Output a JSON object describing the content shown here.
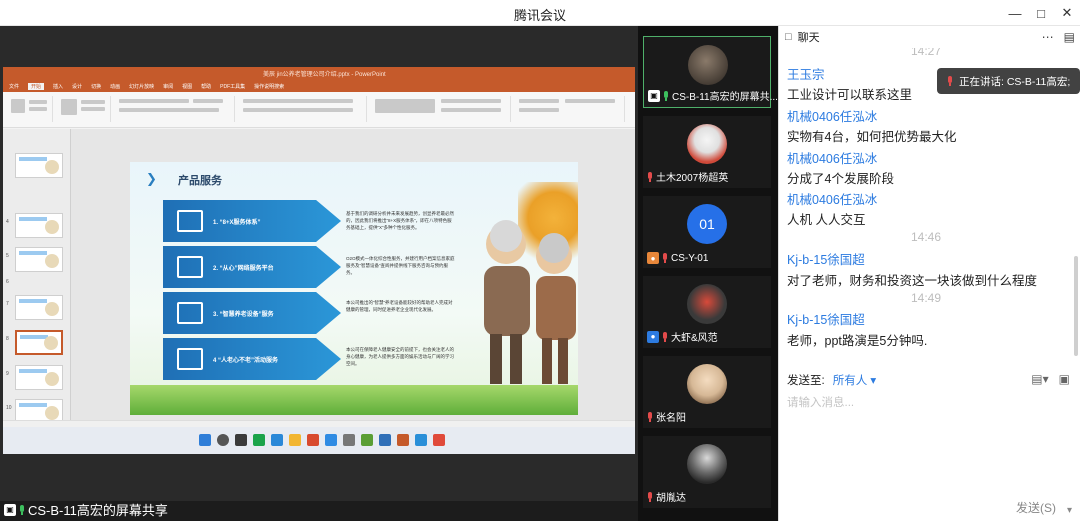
{
  "window": {
    "title": "腾讯会议",
    "min_icon": "minimize-icon",
    "max_icon": "maximize-icon",
    "close_icon": "close-icon"
  },
  "share": {
    "label": "CS-B-11高宏的屏幕共享",
    "ppt": {
      "doc_title": "美辰 jin公养老管理公司介绍.pptx - PowerPoint",
      "tabs": [
        "文件",
        "开始",
        "插入",
        "设计",
        "切换",
        "动画",
        "幻灯片放映",
        "审阅",
        "视图",
        "帮助",
        "PDF工具集",
        "操作说明搜索"
      ],
      "slide_numbers": [
        "4",
        "5",
        "6",
        "7",
        "8",
        "9",
        "10"
      ],
      "slide": {
        "title": "产品服务",
        "services": [
          {
            "label": "1. “8+X服务体系”",
            "desc": "基于我们的调研分析并未来发展趋势，创显养老最必然的，因此我们将推出“8+X服务体系”，即在八项特色服务基础上，提供“X”多种个性化服务。"
          },
          {
            "label": "2. “从心”网络服务平台",
            "desc": "O2O模式一体化综合性服务，并建行用户档案信息家庭服务及“智慧设备”查阅并提供线下服务咨询与预约服务。"
          },
          {
            "label": "3. “智慧养老设备”服务",
            "desc": "本公司推出的“智慧”养老设备能较好的帮助老人完成对健康的管理，同时促进养老企业现代化发展。"
          },
          {
            "label": "4 “人老心不老”活动服务",
            "desc": "本公司在保障老人健康安全的前提下，也会关注老人的身心健康，为老人提供多方面的娱乐活动与广阔的学习空间。"
          }
        ]
      }
    }
  },
  "participants": [
    {
      "name": "CS-B-11高宏的屏幕共...",
      "active": true
    },
    {
      "name": "土木2007杨超英"
    },
    {
      "name": "CS-Y-01",
      "initials": "01"
    },
    {
      "name": "大虾&风范"
    },
    {
      "name": "张名阳"
    },
    {
      "name": "胡胤达"
    }
  ],
  "chat": {
    "title": "聊天",
    "speaking_label": "正在讲话: CS-B-11高宏;",
    "messages": [
      {
        "time": "14:27"
      },
      {
        "sender": "王玉宗",
        "text": "工业设计可以联系这里"
      },
      {
        "sender": "机械0406任泓冰",
        "text": "实物有4台，如何把优势最大化"
      },
      {
        "sender": "机械0406任泓冰",
        "text": "分成了4个发展阶段"
      },
      {
        "sender": "机械0406任泓冰",
        "text": "人机 人人交互"
      },
      {
        "time": "14:46"
      },
      {
        "sender": "Kj-b-15徐国超",
        "text": "对了老师，财务和投资这一块该做到什么程度"
      },
      {
        "time": "14:49"
      },
      {
        "sender": "Kj-b-15徐国超",
        "text": "老师，ppt路演是5分钟吗."
      }
    ],
    "send_to_label": "发送至:",
    "send_to_value": "所有人",
    "input_placeholder": "请输入消息...",
    "send_label": "发送(S)"
  }
}
